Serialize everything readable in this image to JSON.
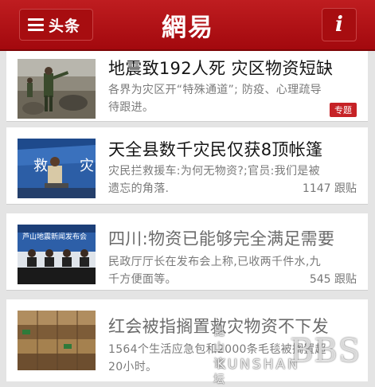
{
  "header": {
    "menu_label": "头条",
    "logo": "網易",
    "info_label": "i",
    "colors": {
      "bar": "#b01217",
      "text": "#ffffff"
    }
  },
  "articles": [
    {
      "title": "地震致192人死 灾区物资短缺",
      "summary": "各界为灾区开“特殊通道”; 防疫、心理疏导待跟进。",
      "tag": "专题",
      "thumb_icon": "rescue-photo"
    },
    {
      "title": "天全县数千灾民仅获8顶帐篷",
      "summary": "灾民拦救援车:为何无物资?;官员:我们是被遗忘的角落.",
      "follow": "1147 跟贴",
      "thumb_icon": "tent-photo"
    },
    {
      "title": "四川:物资已能够完全满足需要",
      "summary": "民政厅厅长在发布会上称,已收两千件水,九千方便面等。",
      "follow": "545 跟贴",
      "thumb_icon": "press-conference-photo"
    },
    {
      "title": "红会被指搁置救灾物资不下发",
      "summary": "1564个生活应急包和2000条毛毯被搁置超20小时。",
      "thumb_icon": "supplies-photo"
    }
  ],
  "watermark": {
    "chinese": "昆山论坛",
    "english": "KUNSHAN",
    "big": "BBS"
  }
}
